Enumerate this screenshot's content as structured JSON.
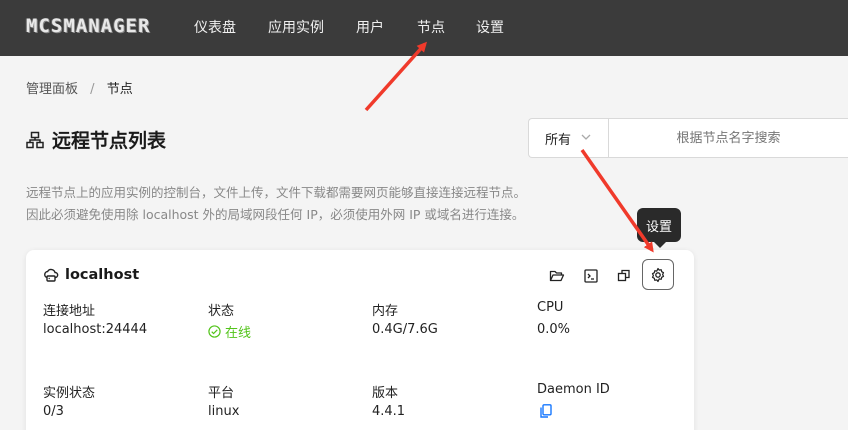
{
  "header": {
    "logo": "MCSMANAGER",
    "nav": [
      "仪表盘",
      "应用实例",
      "用户",
      "节点",
      "设置"
    ]
  },
  "breadcrumb": {
    "root": "管理面板",
    "sep": "/",
    "current": "节点"
  },
  "page": {
    "title": "远程节点列表"
  },
  "filter": {
    "selected": "所有",
    "placeholder": "根据节点名字搜索"
  },
  "description": {
    "line1": "远程节点上的应用实例的控制台，文件上传，文件下载都需要网页能够直接连接远程节点。",
    "line2": "因此必须避免使用除 localhost 外的局域网段任何 IP，必须使用外网 IP 或域名进行连接。"
  },
  "node": {
    "name": "localhost",
    "fields": [
      {
        "label": "连接地址",
        "value": "localhost:24444"
      },
      {
        "label": "状态",
        "value": "在线"
      },
      {
        "label": "内存",
        "value": "0.4G/7.6G"
      },
      {
        "label": "CPU",
        "value": "0.0%"
      },
      {
        "label": "实例状态",
        "value": "0/3"
      },
      {
        "label": "平台",
        "value": "linux"
      },
      {
        "label": "版本",
        "value": "4.4.1"
      },
      {
        "label": "Daemon ID",
        "value": ""
      }
    ],
    "actions": [
      "folder-icon",
      "terminal-icon",
      "copy-window-icon",
      "gear-icon"
    ]
  },
  "tooltip": {
    "text": "设置"
  },
  "colors": {
    "topbar": "#3b3b3b",
    "online": "#52c41a",
    "accent": "#1677ff",
    "annotation": "#f03a2b"
  }
}
